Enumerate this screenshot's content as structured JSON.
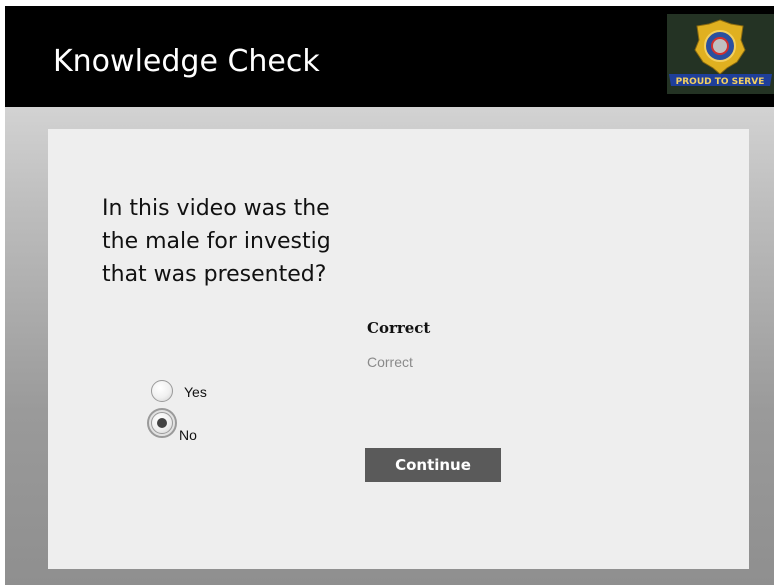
{
  "header": {
    "title": "Knowledge Check"
  },
  "logo": {
    "text": "PROUD TO SERVE"
  },
  "question": {
    "lines": [
      "In this video was the",
      "the male for investig",
      "that was presented?"
    ]
  },
  "options": [
    {
      "label": "Yes",
      "selected": false
    },
    {
      "label": "No",
      "selected": true
    }
  ],
  "feedback": {
    "title": "Correct",
    "text": "Correct"
  },
  "buttons": {
    "continue_label": "Continue"
  },
  "colors": {
    "header_bg": "#000000",
    "button_bg": "#5a5a5a",
    "panel_bg": "#eeeeee"
  }
}
